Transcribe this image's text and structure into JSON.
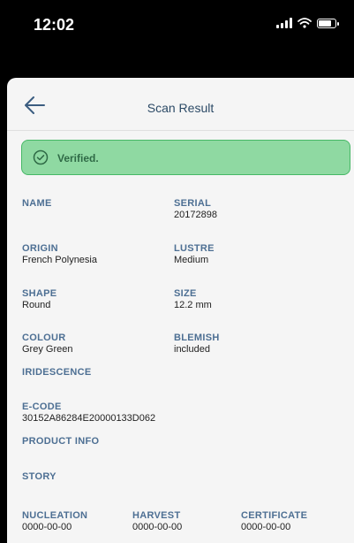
{
  "status_bar": {
    "time": "12:02",
    "battery_level": 0.75
  },
  "nav": {
    "title": "Scan Result"
  },
  "verified": {
    "label": "Verified."
  },
  "fields": {
    "name": {
      "label": "NAME",
      "value": ""
    },
    "serial": {
      "label": "SERIAL",
      "value": "20172898"
    },
    "origin": {
      "label": "ORIGIN",
      "value": "French Polynesia"
    },
    "lustre": {
      "label": "LUSTRE",
      "value": "Medium"
    },
    "shape": {
      "label": "SHAPE",
      "value": "Round"
    },
    "size": {
      "label": "SIZE",
      "value": "12.2 mm"
    },
    "colour": {
      "label": "COLOUR",
      "value": "Grey Green"
    },
    "blemish": {
      "label": "BLEMISH",
      "value": "included"
    },
    "iridescence": {
      "label": "IRIDESCENCE"
    },
    "ecode": {
      "label": "E-CODE",
      "value": "30152A86284E20000133D062"
    },
    "product_info": {
      "label": "PRODUCT INFO"
    },
    "story": {
      "label": "STORY"
    },
    "nucleation": {
      "label": "NUCLEATION",
      "value": "0000-00-00"
    },
    "harvest": {
      "label": "HARVEST",
      "value": "0000-00-00"
    },
    "certificate": {
      "label": "CERTIFICATE",
      "value": "0000-00-00"
    }
  },
  "colors": {
    "accent": "#4d6f93",
    "success_bg": "#8fd9a2",
    "success_border": "#46b866"
  },
  "icons": {
    "back": "arrow-left-icon",
    "verified": "check-circle-icon",
    "signal": "signal-icon",
    "wifi": "wifi-icon",
    "battery": "battery-icon"
  }
}
